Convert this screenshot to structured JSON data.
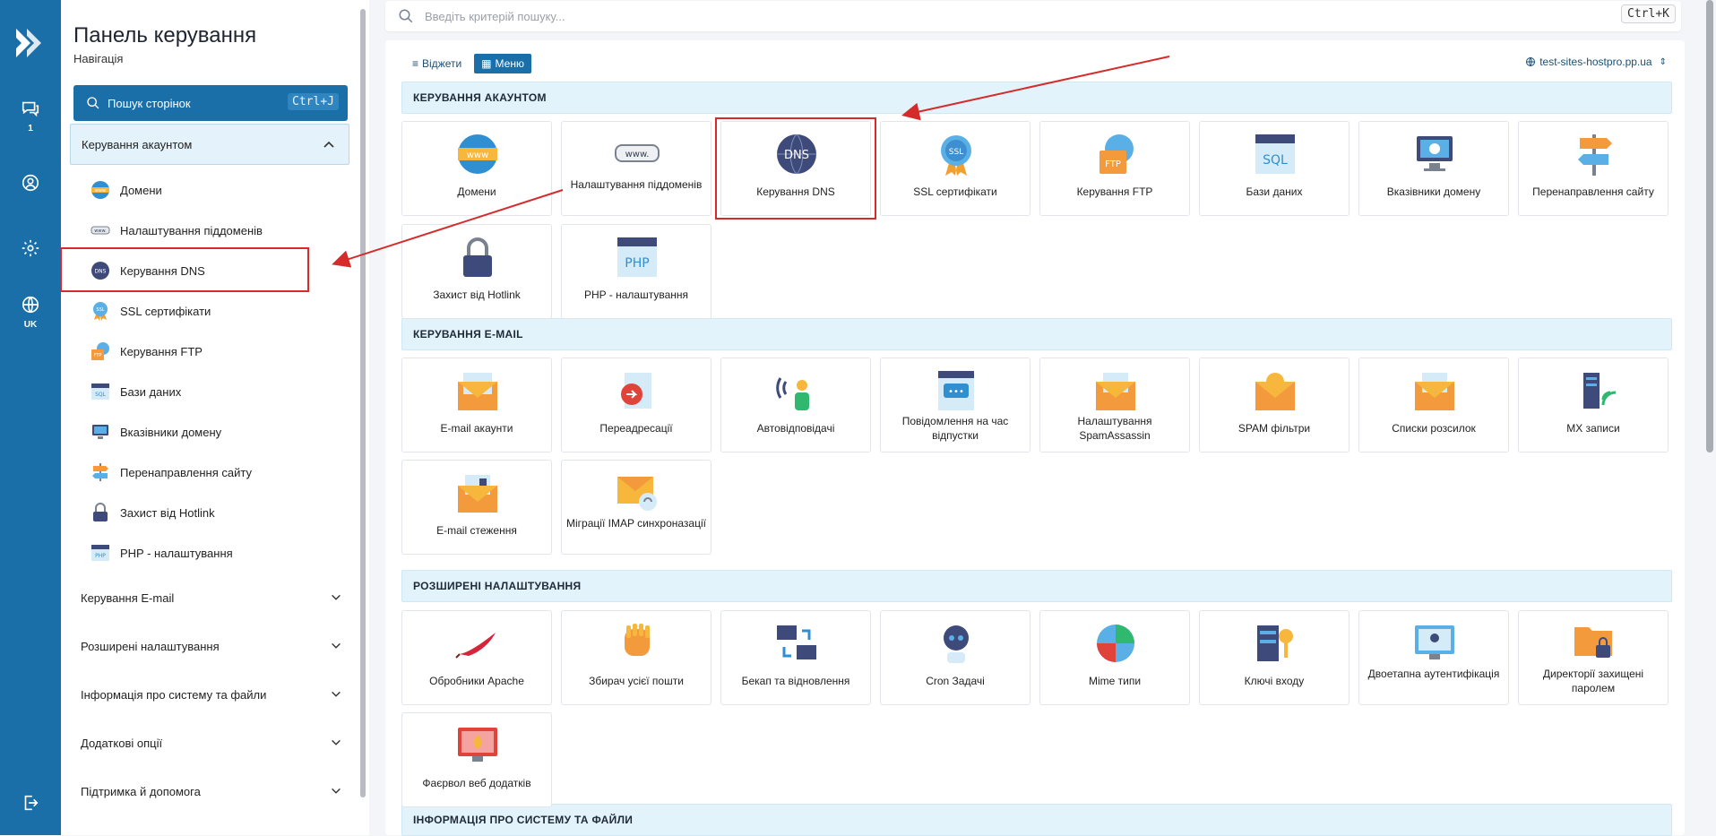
{
  "rail": {
    "items": [
      {
        "name": "chat-icon",
        "sub": "1"
      },
      {
        "name": "user-icon",
        "sub": ""
      },
      {
        "name": "gear-icon",
        "sub": ""
      },
      {
        "name": "globe-icon",
        "sub": "UK"
      },
      {
        "name": "logout-icon",
        "sub": ""
      }
    ]
  },
  "sidebar": {
    "title": "Панель керування",
    "subtitle": "Навігація",
    "search_label": "Пошук сторінок",
    "search_shortcut": "Ctrl+J",
    "active_section": "Керування акаунтом",
    "items": [
      {
        "label": "Домени",
        "icon": "www-globe-icon"
      },
      {
        "label": "Налаштування піддоменів",
        "icon": "subdomain-icon"
      },
      {
        "label": "Керування DNS",
        "icon": "dns-icon"
      },
      {
        "label": "SSL сертифікати",
        "icon": "ssl-badge-icon"
      },
      {
        "label": "Керування FTP",
        "icon": "ftp-folder-icon"
      },
      {
        "label": "Бази даних",
        "icon": "sql-database-icon"
      },
      {
        "label": "Вказівники домену",
        "icon": "domain-pointer-icon"
      },
      {
        "label": "Перенаправлення сайту",
        "icon": "signpost-icon"
      },
      {
        "label": "Захист від Hotlink",
        "icon": "lock-icon"
      },
      {
        "label": "PHP - налаштування",
        "icon": "php-icon"
      }
    ],
    "groups": [
      {
        "label": "Керування E-mail"
      },
      {
        "label": "Розширені налаштування"
      },
      {
        "label": "Інформація про систему та файли"
      },
      {
        "label": "Додаткові опції"
      },
      {
        "label": "Підтримка й допомога"
      }
    ]
  },
  "top_search": {
    "placeholder": "Введіть критерій пошуку...",
    "shortcut": "Ctrl+K"
  },
  "main": {
    "view_widgets": "Віджети",
    "view_menu": "Меню",
    "domain": "test-sites-hostpro.pp.ua",
    "sections": [
      {
        "title": "КЕРУВАННЯ АКАУНТОМ",
        "tiles": [
          {
            "label": "Домени",
            "icon": "www-globe-icon"
          },
          {
            "label": "Налаштування піддоменів",
            "icon": "subdomain-icon"
          },
          {
            "label": "Керування DNS",
            "icon": "dns-icon"
          },
          {
            "label": "SSL сертифікати",
            "icon": "ssl-badge-icon"
          },
          {
            "label": "Керування FTP",
            "icon": "ftp-folder-icon"
          },
          {
            "label": "Бази даних",
            "icon": "sql-database-icon"
          },
          {
            "label": "Вказівники домену",
            "icon": "domain-pointer-icon"
          },
          {
            "label": "Перенаправлення сайту",
            "icon": "signpost-icon"
          },
          {
            "label": "Захист від Hotlink",
            "icon": "lock-icon"
          },
          {
            "label": "PHP - налаштування",
            "icon": "php-icon"
          }
        ]
      },
      {
        "title": "КЕРУВАННЯ E-MAIL",
        "tiles": [
          {
            "label": "E-mail акаунти",
            "icon": "email-envelope-icon"
          },
          {
            "label": "Переадресації",
            "icon": "forwarding-icon"
          },
          {
            "label": "Автовідповідачі",
            "icon": "autoresponder-icon"
          },
          {
            "label": "Повідомлення на час відпустки",
            "icon": "vacation-message-icon"
          },
          {
            "label": "Налаштування SpamAssassin",
            "icon": "spamassassin-icon"
          },
          {
            "label": "SPAM фільтри",
            "icon": "spam-filter-icon"
          },
          {
            "label": "Списки розсилок",
            "icon": "mailing-list-icon"
          },
          {
            "label": "MX записи",
            "icon": "mx-server-icon"
          },
          {
            "label": "E-mail стеження",
            "icon": "email-tracking-icon"
          },
          {
            "label": "Міграції IMAP синхроназації",
            "icon": "imap-migration-icon"
          }
        ]
      },
      {
        "title": "РОЗШИРЕНІ НАЛАШТУВАННЯ",
        "tiles": [
          {
            "label": "Обробники Apache",
            "icon": "apache-feather-icon"
          },
          {
            "label": "Збирач усієї пошти",
            "icon": "catch-all-glove-icon"
          },
          {
            "label": "Бекап та відновлення",
            "icon": "backup-icon"
          },
          {
            "label": "Cron Задачі",
            "icon": "cron-robot-icon"
          },
          {
            "label": "Mime типи",
            "icon": "mime-types-icon"
          },
          {
            "label": "Ключі входу",
            "icon": "login-keys-icon"
          },
          {
            "label": "Двоетапна аутентифікація",
            "icon": "two-factor-icon"
          },
          {
            "label": "Директорії захищені паролем",
            "icon": "password-folder-icon"
          },
          {
            "label": "Фаєрвол веб додатків",
            "icon": "firewall-icon"
          }
        ]
      },
      {
        "title": "ІНФОРМАЦІЯ ПРО СИСТЕМУ ТА ФАЙЛИ",
        "tiles": []
      }
    ]
  },
  "colors": {
    "rail": "#1a6fa8",
    "accent": "#1a6fa8",
    "section_bg": "#e2f3fb",
    "annotation": "#d52b2b"
  }
}
